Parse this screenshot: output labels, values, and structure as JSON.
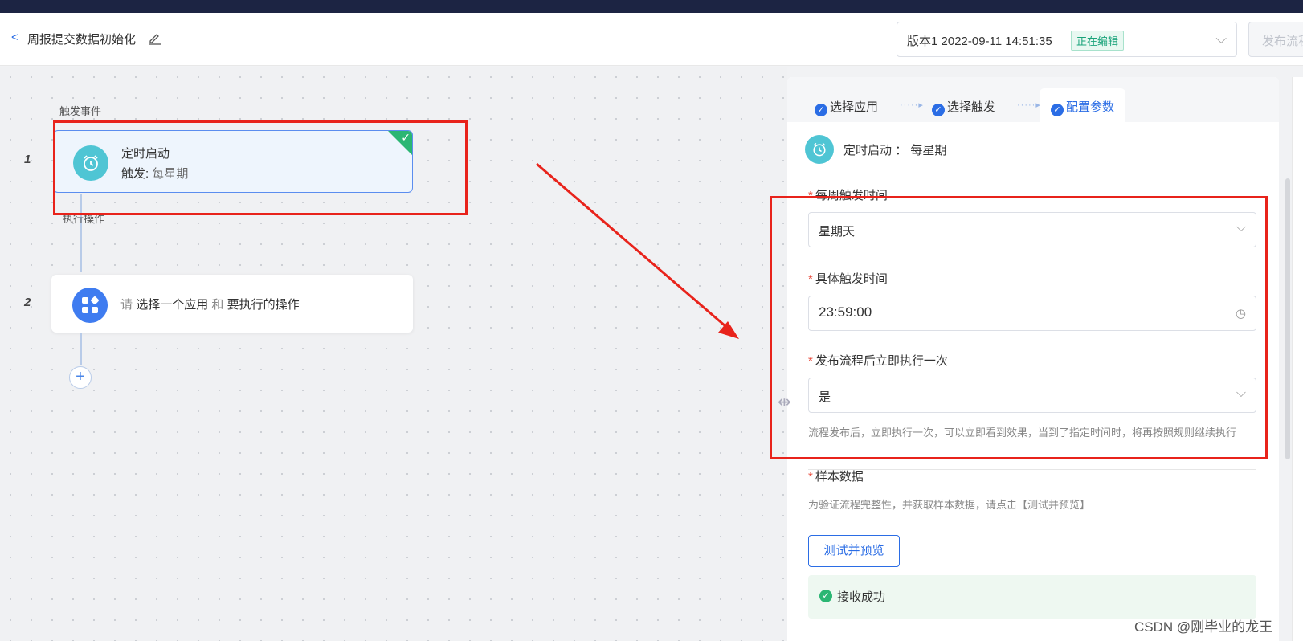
{
  "header": {
    "back_icon": "chevron-left-icon",
    "title": "周报提交数据初始化",
    "edit_icon": "pencil-icon",
    "version_text": "版本1  2022-09-11 14:51:35",
    "version_status": "正在编辑",
    "publish_label": "发布流程"
  },
  "flow": {
    "trigger_section": "触发事件",
    "action_section": "执行操作",
    "node1": {
      "index": "1",
      "title": "定时启动",
      "sub_prefix": "触发:",
      "sub_value": "每星期",
      "icon": "alarm-clock-icon"
    },
    "node2": {
      "index": "2",
      "text_a": "请",
      "text_b": "选择一个应用",
      "text_c": "和",
      "text_d": "要执行的操作",
      "icon": "apps-icon"
    },
    "add_label": "+"
  },
  "panel": {
    "tabs": [
      {
        "label": "选择应用",
        "done": true
      },
      {
        "label": "选择触发",
        "done": true
      },
      {
        "label": "配置参数",
        "done": true,
        "active": true
      }
    ],
    "summary": "定时启动 ： 每星期",
    "fields": {
      "weekday": {
        "label": "每周触发时间",
        "value": "星期天"
      },
      "time": {
        "label": "具体触发时间",
        "value": "23:59:00"
      },
      "run_now": {
        "label": "发布流程后立即执行一次",
        "value": "是",
        "hint": "流程发布后，立即执行一次，可以立即看到效果，当到了指定时间时，将再按照规则继续执行"
      }
    },
    "sample": {
      "label": "样本数据",
      "hint": "为验证流程完整性，并获取样本数据，请点击【测试并预览】",
      "button": "测试并预览",
      "status": "接收成功"
    }
  },
  "watermark": "CSDN @刚毕业的龙王",
  "colors": {
    "accent": "#2b6de5",
    "success": "#2bb673",
    "highlight": "#e8231b",
    "topbar": "#1c2443"
  }
}
